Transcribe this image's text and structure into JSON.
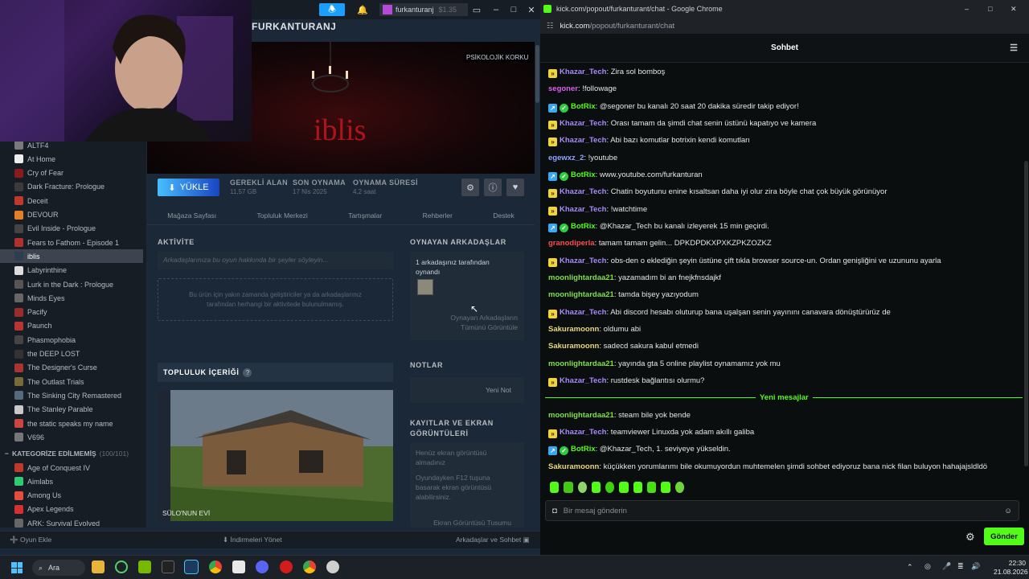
{
  "steam": {
    "user": "furkanturanj",
    "wallet": "$1.35",
    "game_title": "FURKANTURANJ",
    "hero_title": "iblis",
    "hero_tag": "PSİKOLOJİK KORKU",
    "install_label": "YÜKLE",
    "stats": [
      {
        "k": "GEREKLİ ALAN",
        "v": "11,57 GB"
      },
      {
        "k": "SON OYNAMA",
        "v": "17 Nis 2025"
      },
      {
        "k": "OYNAMA SÜRESİ",
        "v": "4,2 saat"
      }
    ],
    "subnav": [
      "Mağaza Sayfası",
      "Topluluk Merkezi",
      "Tartışmalar",
      "Rehberler",
      "Destek"
    ],
    "activity_title": "AKTİVİTE",
    "activity_placeholder": "Arkadaşlarınıza bu oyun hakkında bir şeyler söyleyin...",
    "activity_empty": "Bu ürün için yakın zamanda geliştiriciler ya da arkadaşlarınız tarafından herhangi bir aktivitede bulunulmamış.",
    "friends_title": "OYNAYAN ARKADAŞLAR",
    "friends_count": "1 arkadaşınız tarafından oynandı",
    "friends_link": "Oynayan Arkadaşların Tümünü Görüntüle",
    "community_title": "TOPLULUK İÇERİĞİ",
    "community_caption": "SÜLO'NUN EVİ",
    "notes_title": "NOTLAR",
    "notes_new": "Yeni Not",
    "shots_title": "KAYITLAR VE EKRAN GÖRÜNTÜLERİ",
    "shots_line1": "Henüz ekran görüntüsü almadınız",
    "shots_line2": "Oyundayken F12 tuşuna basarak ekran görüntüsü alabilirsiniz.",
    "shots_link": "Ekran Görüntüsü Tusumu",
    "games": [
      "ALTF4",
      "At Home",
      "Cry of Fear",
      "Dark Fracture: Prologue",
      "Deceit",
      "DEVOUR",
      "Evil Inside - Prologue",
      "Fears to Fathom - Episode 1",
      "iblis",
      "Labyrinthine",
      "Lurk in the Dark : Prologue",
      "Minds Eyes",
      "Pacify",
      "Paunch",
      "Phasmophobia",
      "the DEEP LOST",
      "The Designer's Curse",
      "The Outlast Trials",
      "The Sinking City Remastered",
      "The Stanley Parable",
      "the static speaks my name",
      "V696"
    ],
    "category": "KATEGORİZE EDİLMEMİŞ",
    "category_count": "(100/101)",
    "games2": [
      "Age of Conquest IV",
      "Aimlabs",
      "Among Us",
      "Apex Legends",
      "ARK: Survival Evolved"
    ],
    "footer_add": "Oyun Ekle",
    "footer_downloads": "İndirmeleri Yönet",
    "footer_friends": "Arkadaşlar ve Sohbet"
  },
  "chrome": {
    "title": "kick.com/popout/furkanturant/chat - Google Chrome",
    "url_host": "kick.com",
    "url_path": "/popout/furkanturant/chat",
    "chat_title": "Sohbet"
  },
  "chat": {
    "messages": [
      {
        "b": [
          "y"
        ],
        "u": "Khazar_Tech",
        "c": "#a78bfa",
        "t": "Zira sol bomboş"
      },
      {
        "b": [],
        "u": "segoner",
        "c": "#e05cf0",
        "t": "!followage"
      },
      {
        "b": [
          "bl",
          "g"
        ],
        "u": "BotRix",
        "c": "#53fc18",
        "t": "@segoner bu kanalı 20 saat 20 dakika süredir takip ediyor!"
      },
      {
        "b": [
          "y"
        ],
        "u": "Khazar_Tech",
        "c": "#a78bfa",
        "t": "Orası tamam da şimdi chat senin üstünü kapatıyo ve kamera"
      },
      {
        "b": [
          "y"
        ],
        "u": "Khazar_Tech",
        "c": "#a78bfa",
        "t": "Abi bazı komutlar botrixin kendi komutları"
      },
      {
        "b": [],
        "u": "egewxz_2",
        "c": "#93a4ff",
        "t": "!youtube"
      },
      {
        "b": [
          "bl",
          "g"
        ],
        "u": "BotRix",
        "c": "#53fc18",
        "t": "www.youtube.com/furkanturan"
      },
      {
        "b": [
          "y"
        ],
        "u": "Khazar_Tech",
        "c": "#a78bfa",
        "t": "Chatin boyutunu enine kısaltsan daha iyi olur zira böyle chat çok büyük görünüyor"
      },
      {
        "b": [
          "y"
        ],
        "u": "Khazar_Tech",
        "c": "#a78bfa",
        "t": "!watchtime"
      },
      {
        "b": [
          "bl",
          "g"
        ],
        "u": "BotRix",
        "c": "#53fc18",
        "t": "@Khazar_Tech bu kanalı izleyerek 15 min geçirdi."
      },
      {
        "b": [],
        "u": "granodiperla",
        "c": "#ff4d4d",
        "t": "tamam tamam gelin... DPKDPDKXPXKZPKZOZKZ"
      },
      {
        "b": [
          "y"
        ],
        "u": "Khazar_Tech",
        "c": "#a78bfa",
        "t": "obs-den o eklediğin şeyin üstüne çift tıkla browser source-un. Ordan genişliğini ve uzununu ayarla"
      },
      {
        "b": [],
        "u": "moonlightardaa21",
        "c": "#7ee04a",
        "t": "yazamadım bi an fnejkfnsdajkf"
      },
      {
        "b": [],
        "u": "moonlightardaa21",
        "c": "#7ee04a",
        "t": "tamda bişey yazıyodum"
      },
      {
        "b": [
          "y"
        ],
        "u": "Khazar_Tech",
        "c": "#a78bfa",
        "t": "Abi discord hesabı oluturup bana uşalşan senin yayınını canavara dönüştürürüz de"
      },
      {
        "b": [],
        "u": "Sakuramoonn",
        "c": "#e8d87a",
        "t": "oldumu abi"
      },
      {
        "b": [],
        "u": "Sakuramoonn",
        "c": "#e8d87a",
        "t": "sadecd sakura kabul etmedi"
      },
      {
        "b": [],
        "u": "moonlightardaa21",
        "c": "#7ee04a",
        "t": "yayında gta 5 online playlist oynamamız yok mu"
      },
      {
        "b": [
          "y"
        ],
        "u": "Khazar_Tech",
        "c": "#a78bfa",
        "t": "rustdesk bağlantısı olurmu?"
      },
      {
        "b": [],
        "u": "moonlightardaa21",
        "c": "#7ee04a",
        "t": "steam bile yok bende"
      },
      {
        "b": [
          "y"
        ],
        "u": "Khazar_Tech",
        "c": "#a78bfa",
        "t": "teamviewer Linuxda yok adam akıllı galiba"
      },
      {
        "b": [
          "bl",
          "g"
        ],
        "u": "BotRix",
        "c": "#53fc18",
        "t": "@Khazar_Tech, 1. seviyeye yükseldin."
      },
      {
        "b": [],
        "u": "Sakuramoonn",
        "c": "#e8d87a",
        "t": "küçükken yorumlarımı bile okumuyordun muhtemelen şimdi sohbet ediyoruz bana nick filan buluyon hahajajsldldö"
      }
    ],
    "new_messages": "Yeni mesajlar",
    "input_placeholder": "Bir mesaj gönderin",
    "send": "Gönder"
  },
  "taskbar": {
    "search": "Ara",
    "time": "22:30",
    "date": "21.08.2026"
  }
}
